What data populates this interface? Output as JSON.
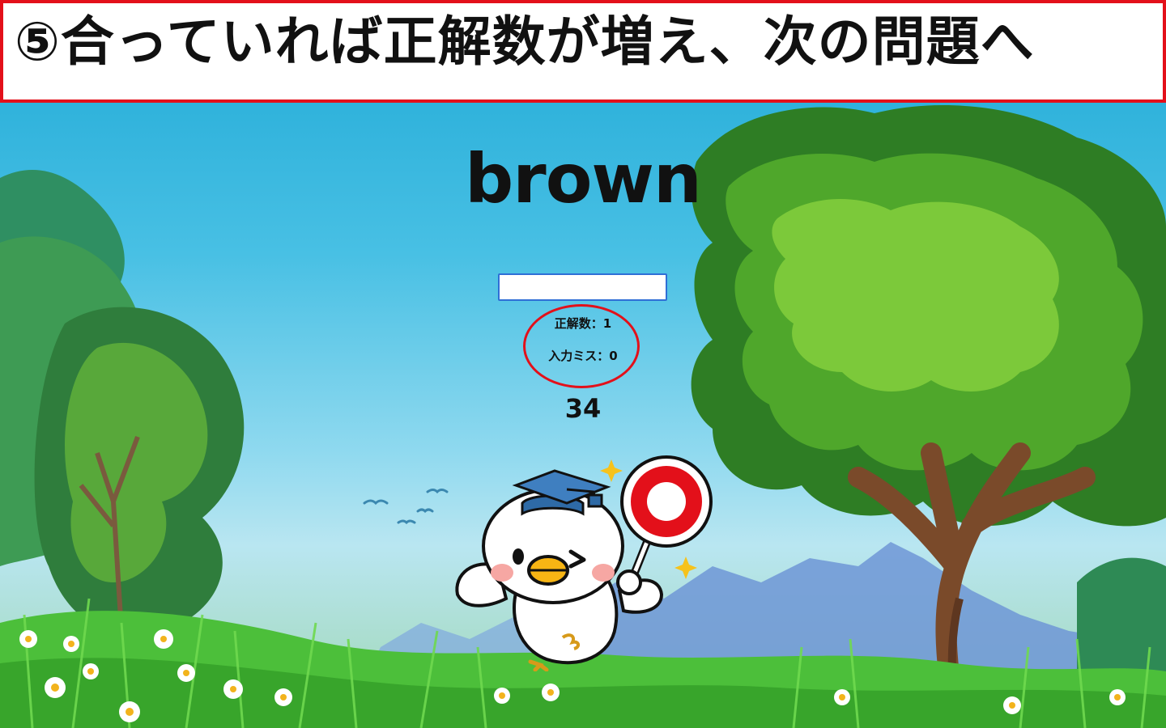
{
  "banner": {
    "text": "⑤合っていれば正解数が増え、次の問題へ"
  },
  "game": {
    "word": "brown",
    "input_value": "",
    "correct_label": "正解数：1",
    "miss_label": "入力ミス：0",
    "timer": "34"
  },
  "colors": {
    "banner_border": "#e3101a",
    "sky": "#1fa9d6",
    "highlight_circle": "#e3101a",
    "input_border": "#2f6fd6",
    "maru_sign": "#e3101a"
  },
  "icons": {
    "mascot": "chick-mascot-with-graduation-cap-icon",
    "sign": "correct-maru-sign-icon"
  }
}
